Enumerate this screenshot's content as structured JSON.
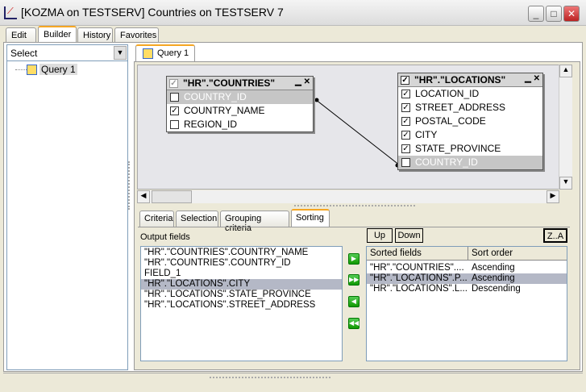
{
  "window": {
    "title": "[KOZMA on TESTSERV] Countries on TESTSERV 7"
  },
  "main_tabs": [
    "Edit",
    "Builder",
    "History",
    "Favorites"
  ],
  "left": {
    "select_value": "Select",
    "tree": [
      "Query 1"
    ]
  },
  "query_tab": "Query 1",
  "diagram": {
    "countries": {
      "title": "\"HR\".\"COUNTRIES\"",
      "fields": [
        {
          "name": "COUNTRY_ID",
          "checked": true,
          "selected": true
        },
        {
          "name": "COUNTRY_NAME",
          "checked": true
        },
        {
          "name": "REGION_ID",
          "checked": false
        }
      ]
    },
    "locations": {
      "title": "\"HR\".\"LOCATIONS\"",
      "fields": [
        {
          "name": "LOCATION_ID",
          "checked": true
        },
        {
          "name": "STREET_ADDRESS",
          "checked": true
        },
        {
          "name": "POSTAL_CODE",
          "checked": true
        },
        {
          "name": "CITY",
          "checked": true
        },
        {
          "name": "STATE_PROVINCE",
          "checked": true
        },
        {
          "name": "COUNTRY_ID",
          "checked": true,
          "selected": true
        }
      ]
    }
  },
  "sub_tabs": [
    "Criteria",
    "Selection",
    "Grouping criteria",
    "Sorting"
  ],
  "sorting": {
    "output_label": "Output fields",
    "output_fields": [
      "\"HR\".\"COUNTRIES\".COUNTRY_NAME",
      "\"HR\".\"COUNTRIES\".COUNTRY_ID",
      "FIELD_1",
      "\"HR\".\"LOCATIONS\".CITY",
      "\"HR\".\"LOCATIONS\".STATE_PROVINCE",
      "\"HR\".\"LOCATIONS\".STREET_ADDRESS"
    ],
    "up": "Up",
    "down": "Down",
    "za": "Z..A",
    "headers": [
      "Sorted fields",
      "Sort order"
    ],
    "rows": [
      [
        "\"HR\".\"COUNTRIES\"....",
        "Ascending"
      ],
      [
        "\"HR\".\"LOCATIONS\".P...",
        "Ascending"
      ],
      [
        "\"HR\".\"LOCATIONS\".L...",
        "Descending"
      ]
    ]
  }
}
